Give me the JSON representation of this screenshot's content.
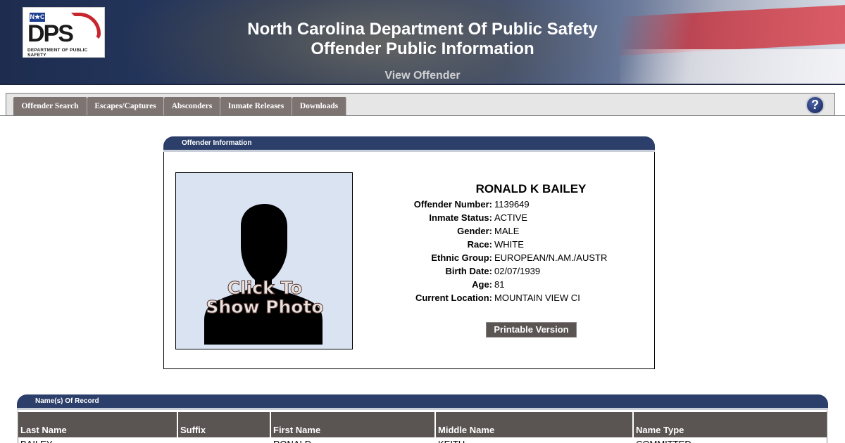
{
  "header": {
    "logo_badge": "N★C",
    "logo_main": "DPS",
    "logo_caption": "DEPARTMENT OF PUBLIC SAFETY",
    "title_line1": "North Carolina Department Of Public Safety",
    "title_line2": "Offender Public Information",
    "subtitle": "View Offender"
  },
  "nav": {
    "tabs": [
      "Offender Search",
      "Escapes/Captures",
      "Absconders",
      "Inmate Releases",
      "Downloads"
    ],
    "help_glyph": "?"
  },
  "offender_panel": {
    "heading": "Offender Information",
    "photo_caption_line1": "Click To",
    "photo_caption_line2": "Show Photo",
    "name": "RONALD K BAILEY",
    "fields": [
      {
        "label": "Offender Number:",
        "value": "1139649"
      },
      {
        "label": "Inmate Status:",
        "value": "ACTIVE"
      },
      {
        "label": "Gender:",
        "value": "MALE"
      },
      {
        "label": "Race:",
        "value": "WHITE"
      },
      {
        "label": "Ethnic Group:",
        "value": "EUROPEAN/N.AM./AUSTR"
      },
      {
        "label": "Birth Date:",
        "value": "02/07/1939"
      },
      {
        "label": "Age:",
        "value": "81"
      },
      {
        "label": "Current Location:",
        "value": "MOUNTAIN VIEW CI"
      }
    ],
    "printable_label": "Printable Version"
  },
  "names_of_record": {
    "heading": "Name(s) Of Record",
    "columns": [
      "Last Name",
      "Suffix",
      "First Name",
      "Middle Name",
      "Name Type"
    ],
    "rows": [
      [
        "BAILEY",
        "",
        "RONALD",
        "KEITH",
        "COMMITTED"
      ]
    ]
  },
  "colors": {
    "panel_header": "#2b3f6a",
    "tab_bg": "#7d7472",
    "table_header": "#5a5452"
  }
}
